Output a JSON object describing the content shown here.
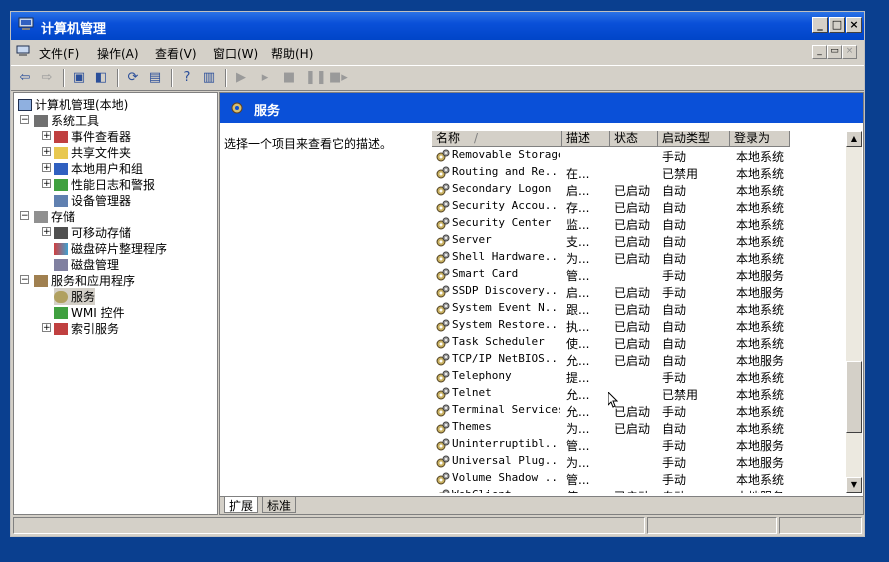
{
  "window": {
    "title": "计算机管理"
  },
  "menu": {
    "items": [
      "文件(F)",
      "操作(A)",
      "查看(V)",
      "窗口(W)",
      "帮助(H)"
    ]
  },
  "tree": {
    "root": "计算机管理(本地)",
    "system_tools": "系统工具",
    "event_viewer": "事件查看器",
    "shared_folders": "共享文件夹",
    "local_users": "本地用户和组",
    "perf_logs": "性能日志和警报",
    "device_manager": "设备管理器",
    "storage": "存储",
    "removable_storage": "可移动存储",
    "defrag": "磁盘碎片整理程序",
    "disk_mgmt": "磁盘管理",
    "services_apps": "服务和应用程序",
    "services": "服务",
    "wmi": "WMI 控件",
    "indexing": "索引服务"
  },
  "panel": {
    "title": "服务",
    "description": "选择一个项目来查看它的描述。"
  },
  "columns": {
    "name": "名称",
    "desc": "描述",
    "status": "状态",
    "startup": "启动类型",
    "logon": "登录为"
  },
  "services": [
    {
      "name": "Removable Storage",
      "desc": "",
      "status": "",
      "startup": "手动",
      "logon": "本地系统"
    },
    {
      "name": "Routing and Re...",
      "desc": "在...",
      "status": "",
      "startup": "已禁用",
      "logon": "本地系统"
    },
    {
      "name": "Secondary Logon",
      "desc": "启...",
      "status": "已启动",
      "startup": "自动",
      "logon": "本地系统"
    },
    {
      "name": "Security Accou...",
      "desc": "存...",
      "status": "已启动",
      "startup": "自动",
      "logon": "本地系统"
    },
    {
      "name": "Security Center",
      "desc": "监...",
      "status": "已启动",
      "startup": "自动",
      "logon": "本地系统"
    },
    {
      "name": "Server",
      "desc": "支...",
      "status": "已启动",
      "startup": "自动",
      "logon": "本地系统"
    },
    {
      "name": "Shell Hardware...",
      "desc": "为...",
      "status": "已启动",
      "startup": "自动",
      "logon": "本地系统"
    },
    {
      "name": "Smart Card",
      "desc": "管...",
      "status": "",
      "startup": "手动",
      "logon": "本地服务"
    },
    {
      "name": "SSDP Discovery...",
      "desc": "启...",
      "status": "已启动",
      "startup": "手动",
      "logon": "本地服务"
    },
    {
      "name": "System Event N...",
      "desc": "跟...",
      "status": "已启动",
      "startup": "自动",
      "logon": "本地系统"
    },
    {
      "name": "System Restore...",
      "desc": "执...",
      "status": "已启动",
      "startup": "自动",
      "logon": "本地系统"
    },
    {
      "name": "Task Scheduler",
      "desc": "使...",
      "status": "已启动",
      "startup": "自动",
      "logon": "本地系统"
    },
    {
      "name": "TCP/IP NetBIOS...",
      "desc": "允...",
      "status": "已启动",
      "startup": "自动",
      "logon": "本地服务"
    },
    {
      "name": "Telephony",
      "desc": "提...",
      "status": "",
      "startup": "手动",
      "logon": "本地系统"
    },
    {
      "name": "Telnet",
      "desc": "允...",
      "status": "",
      "startup": "已禁用",
      "logon": "本地系统"
    },
    {
      "name": "Terminal Services",
      "desc": "允...",
      "status": "已启动",
      "startup": "手动",
      "logon": "本地系统"
    },
    {
      "name": "Themes",
      "desc": "为...",
      "status": "已启动",
      "startup": "自动",
      "logon": "本地系统"
    },
    {
      "name": "Uninterruptibl...",
      "desc": "管...",
      "status": "",
      "startup": "手动",
      "logon": "本地服务"
    },
    {
      "name": "Universal Plug...",
      "desc": "为...",
      "status": "",
      "startup": "手动",
      "logon": "本地服务"
    },
    {
      "name": "Volume Shadow ...",
      "desc": "管...",
      "status": "",
      "startup": "手动",
      "logon": "本地系统"
    },
    {
      "name": "WebClient",
      "desc": "使...",
      "status": "已启动",
      "startup": "自动",
      "logon": "本地服务"
    }
  ],
  "tabs": [
    "扩展",
    "标准"
  ],
  "colors": {
    "titlebar": "#0a50d8",
    "face": "#d4d0c8",
    "desktop": "#0a3f8f"
  },
  "icons": [
    "computer-icon",
    "back-icon",
    "forward-icon",
    "gear-icon",
    "folder-icon",
    "scrollbar-arrow"
  ]
}
